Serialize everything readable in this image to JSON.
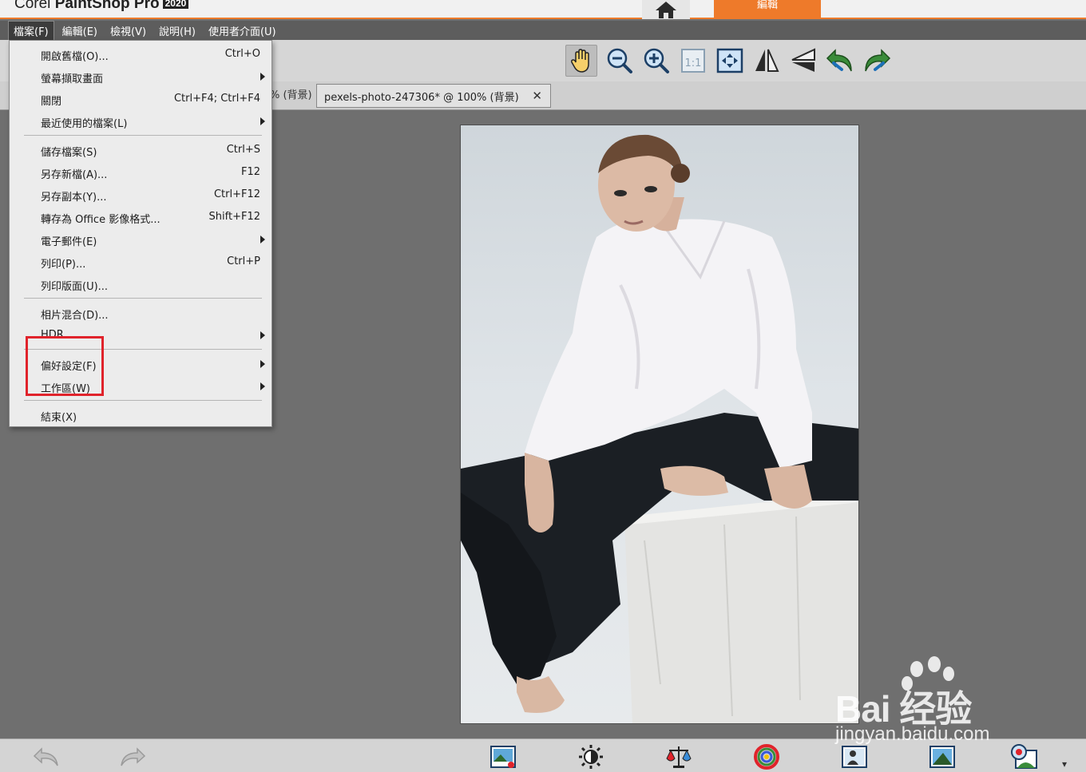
{
  "titlebar": {
    "app_name_prefix": "Corel ",
    "app_name": "PaintShop Pro",
    "year_badge": "2020",
    "home_tab_icon": "home-icon",
    "active_workspace_tab": "編輯"
  },
  "menubar": {
    "items": [
      {
        "label": "檔案(F)",
        "active": true
      },
      {
        "label": "編輯(E)"
      },
      {
        "label": "檢視(V)"
      },
      {
        "label": "說明(H)"
      },
      {
        "label": "使用者介面(U)"
      }
    ]
  },
  "toolbar": {
    "tools": [
      "pan-hand-icon",
      "zoom-out-icon",
      "zoom-in-icon",
      "actual-size-1to1-icon",
      "fit-to-window-icon",
      "flip-icon",
      "mirror-icon",
      "rotate-left-icon",
      "rotate-right-icon"
    ],
    "actual_size_label": "1:1"
  },
  "tabs": {
    "partial_tab_text": "% (背景)",
    "active_tab_text": "pexels-photo-247306* @ 100% (背景)",
    "close_glyph": "✕"
  },
  "file_menu": {
    "items": [
      {
        "label": "開啟舊檔(O)...",
        "shortcut": "Ctrl+O"
      },
      {
        "label": "螢幕擷取畫面",
        "submenu": true
      },
      {
        "label": "關閉",
        "shortcut": "Ctrl+F4; Ctrl+F4"
      },
      {
        "label": "最近使用的檔案(L)",
        "submenu": true
      },
      {
        "label": "儲存檔案(S)",
        "shortcut": "Ctrl+S"
      },
      {
        "label": "另存新檔(A)...",
        "shortcut": "F12"
      },
      {
        "label": "另存副本(Y)...",
        "shortcut": "Ctrl+F12"
      },
      {
        "label": "轉存為 Office 影像格式...",
        "shortcut": "Shift+F12"
      },
      {
        "label": "電子郵件(E)",
        "submenu": true
      },
      {
        "label": "列印(P)...",
        "shortcut": "Ctrl+P"
      },
      {
        "label": "列印版面(U)..."
      },
      {
        "label": "相片混合(D)..."
      },
      {
        "label": "HDR",
        "submenu": true
      },
      {
        "label": "偏好設定(F)",
        "submenu": true
      },
      {
        "label": "工作區(W)",
        "submenu": true
      },
      {
        "label": "結束(X)"
      }
    ]
  },
  "bottombar": {
    "icons": [
      "undo-icon",
      "redo-icon",
      "smart-photo-fix-icon",
      "brightness-icon",
      "color-balance-icon",
      "hue-saturation-icon",
      "photo-adjust-icon",
      "depth-of-field-icon",
      "red-eye-icon",
      "more-chevron-icon"
    ],
    "more_glyph": "▾"
  },
  "watermark": {
    "main_text": "Bai 经验",
    "url_text": "jingyan.baidu.com"
  },
  "colors": {
    "accent_orange": "#ee7a2a",
    "highlight_red": "#e0232b"
  }
}
